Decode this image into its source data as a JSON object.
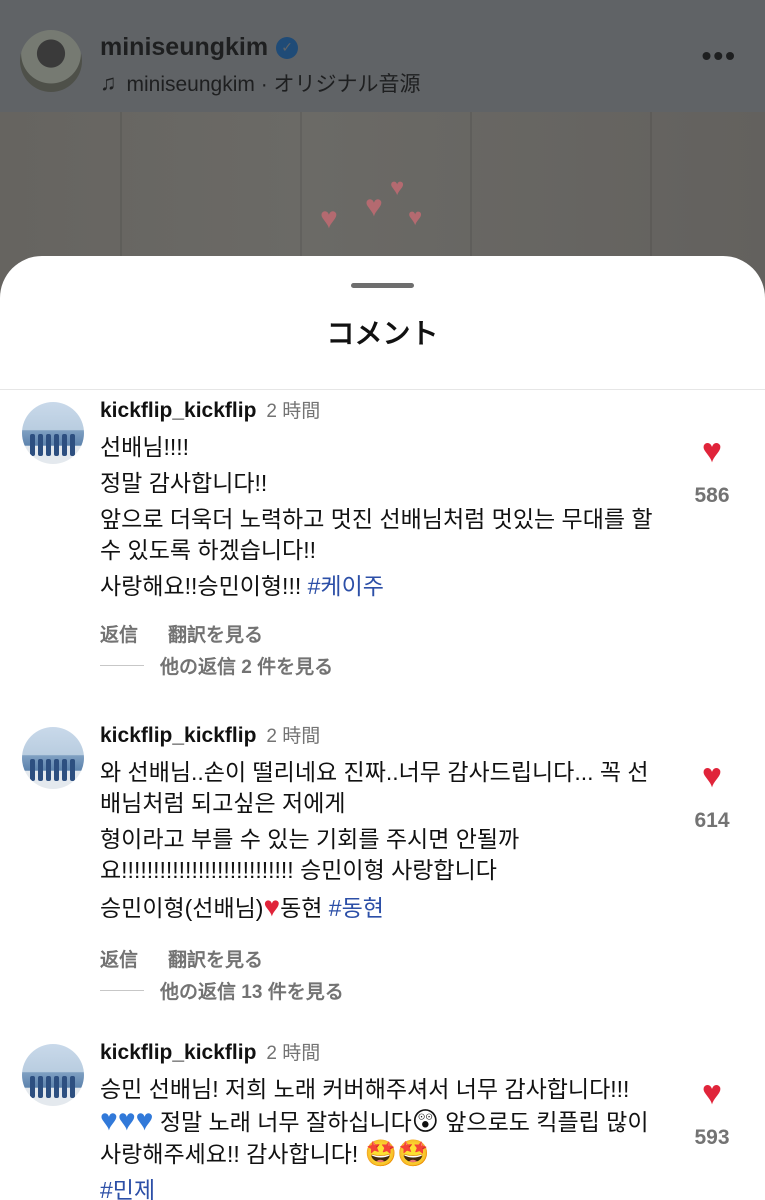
{
  "header": {
    "username": "miniseungkim",
    "audio_label": "miniseungkim · オリジナル音源",
    "more_label": "•••"
  },
  "sheet": {
    "title": "コメント"
  },
  "comments": [
    {
      "username": "kickflip_kickflip",
      "time": "2 時間",
      "lines": [
        "선배님!!!!",
        "정말 감사합니다!!",
        "앞으로 더욱더 노력하고 멋진 선배님처럼 멋있는 무대를 할 수 있도록 하겠습니다!!",
        "사랑해요!!승민이형!!!"
      ],
      "hashtag": "#케이주",
      "likes": "586",
      "reply_label": "返信",
      "translate_label": "翻訳を見る",
      "more_replies": "他の返信 2 件を見る"
    },
    {
      "username": "kickflip_kickflip",
      "time": "2 時間",
      "lines": [
        "와 선배님..손이 떨리네요 진짜..너무 감사드립니다... 꼭 선배님처럼 되고싶은 저에게",
        "형이라고 부를 수 있는 기회를 주시면 안될까요!!!!!!!!!!!!!!!!!!!!!!!!!!! 승민이형 사랑합니다",
        "승민이형(선배님)"
      ],
      "after_heart": "동현",
      "hashtag": "#동현",
      "likes": "614",
      "reply_label": "返信",
      "translate_label": "翻訳を見る",
      "more_replies": "他の返信 13 件を見る"
    },
    {
      "username": "kickflip_kickflip",
      "time": "2 時間",
      "lines": [
        "승민 선배님! 저희 노래 커버해주셔서 너무 감사합니다!!!",
        "정말 노래 너무 잘하십니다",
        "앞으로도 킥플립 많이 사랑해주세요!! 감사합니다!"
      ],
      "hashtag": "#민제",
      "likes": "593"
    }
  ],
  "colors": {
    "like_red": "#e0243a",
    "hashtag_blue": "#2c4fa7",
    "muted_gray": "#737373"
  }
}
